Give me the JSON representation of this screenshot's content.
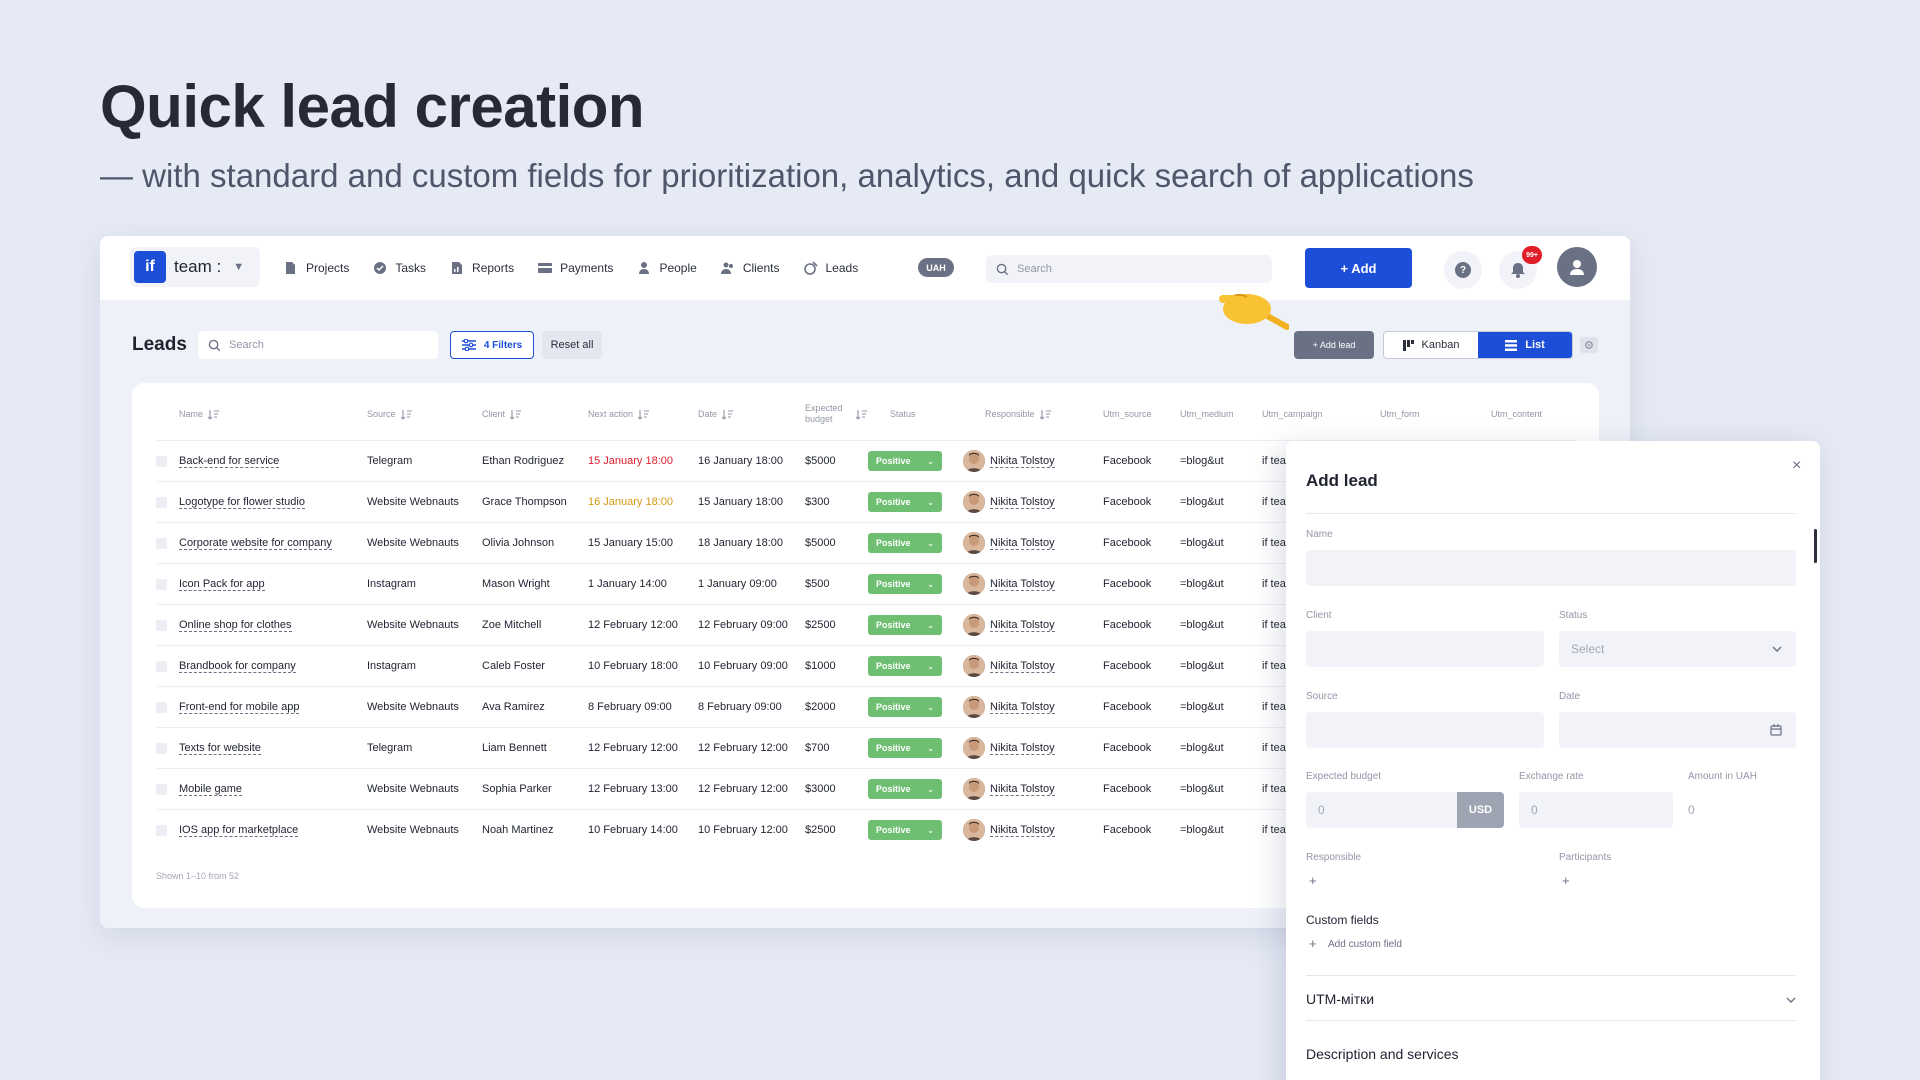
{
  "hero": {
    "title": "Quick lead creation",
    "subtitle": "— with standard and custom fields for prioritization, analytics, and quick search of applications"
  },
  "topbar": {
    "logo_text": "if",
    "team_name": "team :",
    "nav": [
      {
        "label": "Projects",
        "icon": "folder-icon"
      },
      {
        "label": "Tasks",
        "icon": "check-circle-icon"
      },
      {
        "label": "Reports",
        "icon": "report-icon"
      },
      {
        "label": "Payments",
        "icon": "card-icon"
      },
      {
        "label": "People",
        "icon": "person-icon"
      },
      {
        "label": "Clients",
        "icon": "clients-icon"
      },
      {
        "label": "Leads",
        "icon": "leads-icon"
      }
    ],
    "currency": "UAH",
    "search_placeholder": "Search",
    "add_label": "+ Add",
    "help_label": "?",
    "notif_count": "99+"
  },
  "leads_bar": {
    "title": "Leads",
    "search_placeholder": "Search",
    "filters_label": "4 Filters",
    "reset_label": "Reset all",
    "add_lead_label": "+ Add lead",
    "kanban_label": "Kanban",
    "list_label": "List"
  },
  "table": {
    "headers": {
      "name": "Name",
      "source": "Source",
      "client": "Client",
      "next_action": "Next action",
      "date": "Date",
      "expected_budget": "Expected budget",
      "status": "Status",
      "responsible": "Responsible",
      "utm_source": "Utm_source",
      "utm_medium": "Utm_medium",
      "utm_campaign": "Utm_campaign",
      "utm_form": "Utm_form",
      "utm_content": "Utm_content"
    },
    "rows": [
      {
        "name": "Back-end for service",
        "source": "Telegram",
        "client": "Ethan Rodriguez",
        "next_action": "15 January 18:00",
        "next_action_color": "#e11d2a",
        "date": "16 January 18:00",
        "budget": "$5000",
        "status": "Positive",
        "responsible": "Nikita Tolstoy",
        "utm_source": "Facebook",
        "utm_medium": "=blog&ut",
        "utm_campaign": "if tea"
      },
      {
        "name": "Logotype for flower studio",
        "source": "Website Webnauts",
        "client": "Grace Thompson",
        "next_action": "16 January 18:00",
        "next_action_color": "#d49a12",
        "date": "15 January 18:00",
        "budget": "$300",
        "status": "Positive",
        "responsible": "Nikita Tolstoy",
        "utm_source": "Facebook",
        "utm_medium": "=blog&ut",
        "utm_campaign": "if tea"
      },
      {
        "name": "Corporate website for company",
        "source": "Website Webnauts",
        "client": "Olivia Johnson",
        "next_action": "15 January 15:00",
        "next_action_color": "#1f2330",
        "date": "18 January 18:00",
        "budget": "$5000",
        "status": "Positive",
        "responsible": "Nikita Tolstoy",
        "utm_source": "Facebook",
        "utm_medium": "=blog&ut",
        "utm_campaign": "if tea"
      },
      {
        "name": "Icon Pack for app",
        "source": "Instagram",
        "client": "Mason Wright",
        "next_action": "1 January 14:00",
        "next_action_color": "#1f2330",
        "date": "1 January 09:00",
        "budget": "$500",
        "status": "Positive",
        "responsible": "Nikita Tolstoy",
        "utm_source": "Facebook",
        "utm_medium": "=blog&ut",
        "utm_campaign": "if tea"
      },
      {
        "name": "Online shop for clothes",
        "source": "Website Webnauts",
        "client": "Zoe Mitchell",
        "next_action": "12 February 12:00",
        "next_action_color": "#1f2330",
        "date": "12 February 09:00",
        "budget": "$2500",
        "status": "Positive",
        "responsible": "Nikita Tolstoy",
        "utm_source": "Facebook",
        "utm_medium": "=blog&ut",
        "utm_campaign": "if tea"
      },
      {
        "name": "Brandbook for company",
        "source": "Instagram",
        "client": "Caleb Foster",
        "next_action": "10 February 18:00",
        "next_action_color": "#1f2330",
        "date": "10 February 09:00",
        "budget": "$1000",
        "status": "Positive",
        "responsible": "Nikita Tolstoy",
        "utm_source": "Facebook",
        "utm_medium": "=blog&ut",
        "utm_campaign": "if tea"
      },
      {
        "name": "Front-end for mobile app",
        "source": "Website Webnauts",
        "client": "Ava Ramirez",
        "next_action": "8 February 09:00",
        "next_action_color": "#1f2330",
        "date": "8 February 09:00",
        "budget": "$2000",
        "status": "Positive",
        "responsible": "Nikita Tolstoy",
        "utm_source": "Facebook",
        "utm_medium": "=blog&ut",
        "utm_campaign": "if tea"
      },
      {
        "name": "Texts for website",
        "source": "Telegram",
        "client": "Liam Bennett",
        "next_action": "12 February 12:00",
        "next_action_color": "#1f2330",
        "date": "12 February 12:00",
        "budget": "$700",
        "status": "Positive",
        "responsible": "Nikita Tolstoy",
        "utm_source": "Facebook",
        "utm_medium": "=blog&ut",
        "utm_campaign": "if tea"
      },
      {
        "name": "Mobile game",
        "source": "Website Webnauts",
        "client": "Sophia Parker",
        "next_action": "12 February 13:00",
        "next_action_color": "#1f2330",
        "date": "12 February 12:00",
        "budget": "$3000",
        "status": "Positive",
        "responsible": "Nikita Tolstoy",
        "utm_source": "Facebook",
        "utm_medium": "=blog&ut",
        "utm_campaign": "if tea"
      },
      {
        "name": "IOS app for marketplace",
        "source": "Website Webnauts",
        "client": "Noah Martinez",
        "next_action": "10 February 14:00",
        "next_action_color": "#1f2330",
        "date": "10 February 12:00",
        "budget": "$2500",
        "status": "Positive",
        "responsible": "Nikita Tolstoy",
        "utm_source": "Facebook",
        "utm_medium": "=blog&ut",
        "utm_campaign": "if tea"
      }
    ],
    "footer": "Shown 1–10 from 52"
  },
  "add_lead_panel": {
    "title": "Add lead",
    "close_label": "×",
    "name_label": "Name",
    "client_label": "Client",
    "status_label": "Status",
    "status_placeholder": "Select",
    "source_label": "Source",
    "date_label": "Date",
    "budget_label": "Expected budget",
    "budget_value": "0",
    "budget_currency": "USD",
    "exchange_label": "Exchange rate",
    "exchange_value": "0",
    "amount_label": "Amount in UAH",
    "amount_value": "0",
    "responsible_label": "Responsible",
    "participants_label": "Participants",
    "plus": "+",
    "custom_fields_label": "Custom fields",
    "add_custom_field_label": "Add custom field",
    "utm_section": "UTM-мітки",
    "description_section": "Description and services"
  },
  "colors": {
    "accent": "#1d4ed8",
    "positive": "#6fbf73",
    "overdue": "#e11d2a",
    "soon": "#d49a12"
  }
}
